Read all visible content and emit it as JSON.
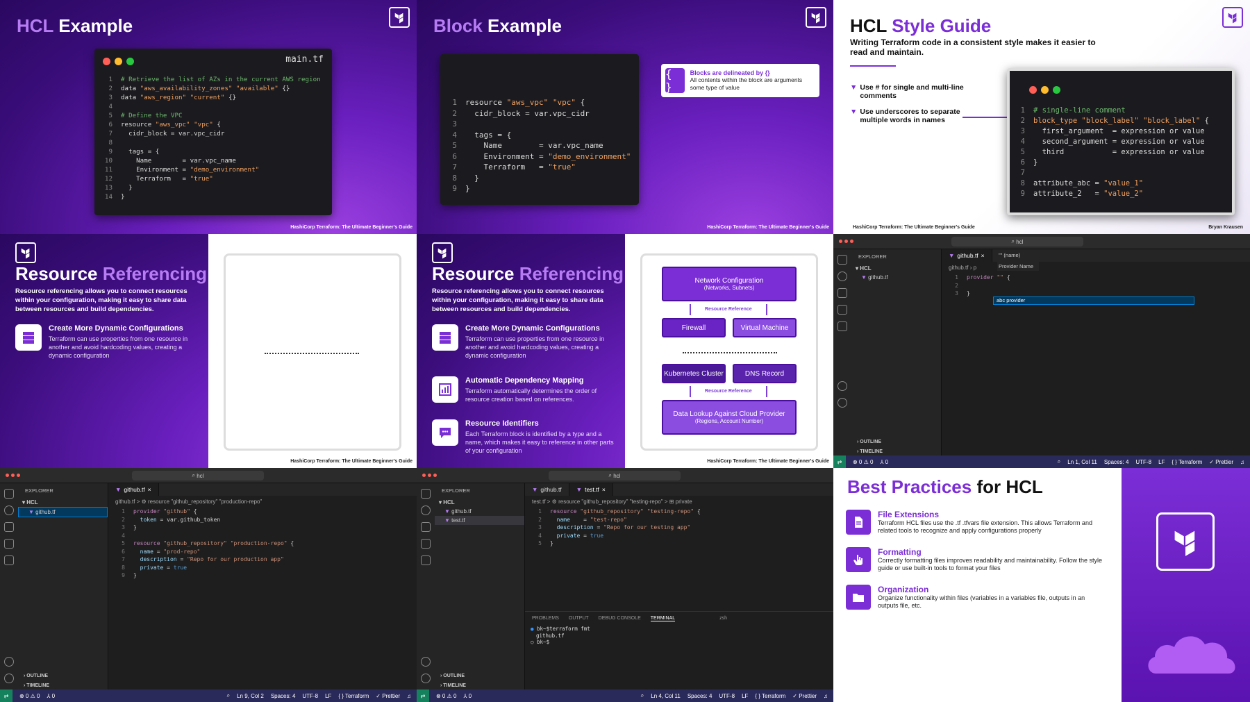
{
  "slides": {
    "hcl_example": {
      "title_accent": "HCL",
      "title_rest": " Example",
      "filename": "main.tf",
      "footer": "HashiCorp Terraform: The Ultimate Beginner's Guide",
      "lines": [
        {
          "n": "1",
          "html": "<span class='cm'># Retrieve the list of AZs in the current AWS region</span>"
        },
        {
          "n": "2",
          "html": "data <span class='st'>\"aws_availability_zones\"</span> <span class='st'>\"available\"</span> {}"
        },
        {
          "n": "3",
          "html": "data <span class='st'>\"aws_region\"</span> <span class='st'>\"current\"</span> {}"
        },
        {
          "n": "4",
          "html": ""
        },
        {
          "n": "5",
          "html": "<span class='cm'># Define the VPC</span>"
        },
        {
          "n": "6",
          "html": "resource <span class='st'>\"aws_vpc\"</span> <span class='st'>\"vpc\"</span> {"
        },
        {
          "n": "7",
          "html": "  cidr_block = var.vpc_cidr"
        },
        {
          "n": "8",
          "html": ""
        },
        {
          "n": "9",
          "html": "  tags = {"
        },
        {
          "n": "10",
          "html": "    Name        = var.vpc_name"
        },
        {
          "n": "11",
          "html": "    Environment = <span class='st'>\"demo_environment\"</span>"
        },
        {
          "n": "12",
          "html": "    Terraform   = <span class='st'>\"true\"</span>"
        },
        {
          "n": "13",
          "html": "  }"
        },
        {
          "n": "14",
          "html": "}"
        }
      ]
    },
    "block_example": {
      "title_accent": "Block",
      "title_rest": " Example",
      "callout_title": "Blocks are delineated by {}",
      "callout_desc": "All contents within the block are arguments some type of value",
      "footer": "HashiCorp Terraform: The Ultimate Beginner's Guide",
      "lines": [
        {
          "n": "1",
          "html": "resource <span class='st'>\"aws_vpc\"</span> <span class='st'>\"vpc\"</span> {"
        },
        {
          "n": "2",
          "html": "  cidr_block = var.vpc_cidr"
        },
        {
          "n": "3",
          "html": ""
        },
        {
          "n": "4",
          "html": "  tags = {"
        },
        {
          "n": "5",
          "html": "    Name        = var.vpc_name"
        },
        {
          "n": "6",
          "html": "    Environment = <span class='st'>\"demo_environment\"</span>"
        },
        {
          "n": "7",
          "html": "    Terraform   = <span class='st'>\"true\"</span>"
        },
        {
          "n": "8",
          "html": "  }"
        },
        {
          "n": "9",
          "html": "}"
        }
      ]
    },
    "style_guide": {
      "title_rest": "HCL ",
      "title_accent": "Style Guide",
      "subtitle": "Writing Terraform code in a consistent style makes it easier to read and maintain.",
      "bullet1": "Use # for single and multi-line comments",
      "bullet2": "Use underscores to separate multiple words in names",
      "footer_left": "HashiCorp Terraform: The Ultimate Beginner's Guide",
      "footer_right": "Bryan Krausen",
      "lines": [
        {
          "n": "1",
          "html": "<span class='cm'># single-line comment</span>"
        },
        {
          "n": "2",
          "html": "<span class='st'>block_type</span> <span class='st'>\"block_label\"</span> <span class='st'>\"block_label\"</span> {"
        },
        {
          "n": "3",
          "html": "  first_argument  = expression or value"
        },
        {
          "n": "4",
          "html": "  second_argument = expression or value"
        },
        {
          "n": "5",
          "html": "  third           = expression or value"
        },
        {
          "n": "6",
          "html": "}"
        },
        {
          "n": "7",
          "html": ""
        },
        {
          "n": "8",
          "html": "attribute_abc = <span class='st'>\"value_1\"</span>"
        },
        {
          "n": "9",
          "html": "attribute_2   = <span class='st'>\"value_2\"</span>"
        }
      ]
    },
    "resource_ref": {
      "title_rest": "Resource ",
      "title_accent": "Referencing",
      "intro": "Resource referencing allows you to connect resources within your configuration, making it easy to share data between resources and build dependencies.",
      "f1_title": "Create More Dynamic Configurations",
      "f1_desc": "Terraform can use properties from one resource in another and avoid hardcoding values, creating a dynamic configuration",
      "f2_title": "Automatic Dependency Mapping",
      "f2_desc": "Terraform automatically determines the order of resource creation based on references.",
      "f3_title": "Resource Identifiers",
      "f3_desc": "Each Terraform block is identified by a type and a name, which makes it easy to reference in other parts of your configuration",
      "footer": "HashiCorp Terraform: The Ultimate Beginner's Guide",
      "diagram": {
        "net_title": "Network Configuration",
        "net_sub": "(Networks, Subnets)",
        "ref_label": "Resource Reference",
        "firewall": "Firewall",
        "vm": "Virtual Machine",
        "k8s": "Kubernetes Cluster",
        "dns": "DNS Record",
        "lookup_title": "Data Lookup Against Cloud Provider",
        "lookup_sub": "(Regions, Account Number)"
      }
    },
    "vscode1": {
      "search": "hcl",
      "explorer": "EXPLORER",
      "folder": "HCL",
      "file": "github.tf",
      "tab": "github.tf",
      "crumb1": "github.tf",
      "crumb2": "p",
      "suggest_header": "\"\" (name)",
      "suggest_hint": "Provider Name",
      "suggest_item": "provider",
      "outline": "OUTLINE",
      "timeline": "TIMELINE",
      "status_errors": "⊗ 0 ⚠ 0",
      "status_ports": "⅄ 0",
      "status_pos": "Ln 1, Col 11",
      "status_spaces": "Spaces: 4",
      "status_enc": "UTF-8",
      "status_eol": "LF",
      "status_lang": "{ } Terraform",
      "status_fmt": "✓ Prettier",
      "lines": [
        {
          "n": "1",
          "html": "<span class='pu'>provider</span> <span class='or'>\"\"</span> {"
        },
        {
          "n": "2",
          "html": ""
        },
        {
          "n": "3",
          "html": "}"
        }
      ]
    },
    "vscode2": {
      "search": "hcl",
      "explorer": "EXPLORER",
      "folder": "HCL",
      "file": "github.tf",
      "tab": "github.tf",
      "crumb": "github.tf > ⚙ resource \"github_repository\" \"production-repo\"",
      "outline": "OUTLINE",
      "timeline": "TIMELINE",
      "status_errors": "⊗ 0 ⚠ 0",
      "status_ports": "⅄ 0",
      "status_pos": "Ln 9, Col 2",
      "status_spaces": "Spaces: 4",
      "status_enc": "UTF-8",
      "status_eol": "LF",
      "status_lang": "{ } Terraform",
      "status_fmt": "✓ Prettier",
      "lines": [
        {
          "n": "1",
          "html": "<span class='pu'>provider</span> <span class='or'>\"github\"</span> {"
        },
        {
          "n": "2",
          "html": "  <span class='blu'>token</span> = var.github_token"
        },
        {
          "n": "3",
          "html": "}"
        },
        {
          "n": "4",
          "html": ""
        },
        {
          "n": "5",
          "html": "<span class='pu'>resource</span> <span class='or'>\"github_repository\"</span> <span class='or'>\"production-repo\"</span> {"
        },
        {
          "n": "6",
          "html": "  <span class='blu'>name</span> = <span class='or'>\"prod-repo\"</span>"
        },
        {
          "n": "7",
          "html": "  <span class='blu'>description</span> = <span class='or'>\"Repo for our production app\"</span>"
        },
        {
          "n": "8",
          "html": "  <span class='blu'>private</span> = <span class='lb'>true</span>"
        },
        {
          "n": "9",
          "html": "}"
        }
      ]
    },
    "vscode3": {
      "search": "hcl",
      "explorer": "EXPLORER",
      "folder": "HCL",
      "file1": "github.tf",
      "file2": "test.tf",
      "tab1": "github.tf",
      "tab2": "test.tf",
      "crumb": "test.tf > ⚙ resource \"github_repository\" \"testing-repo\" > ⊞ private",
      "panel_tabs": [
        "PROBLEMS",
        "OUTPUT",
        "DEBUG CONSOLE",
        "TERMINAL"
      ],
      "shell": "zsh",
      "term1": "bk~$terraform fmt",
      "term2": "github.tf",
      "term3": "bk~$",
      "outline": "OUTLINE",
      "timeline": "TIMELINE",
      "status_errors": "⊗ 0 ⚠ 0",
      "status_ports": "⅄ 0",
      "status_pos": "Ln 4, Col 11",
      "status_spaces": "Spaces: 4",
      "status_enc": "UTF-8",
      "status_eol": "LF",
      "status_lang": "{ } Terraform",
      "status_fmt": "✓ Prettier",
      "lines": [
        {
          "n": "1",
          "html": "<span class='pu'>resource</span> <span class='or'>\"github_repository\"</span> <span class='or'>\"testing-repo\"</span> {"
        },
        {
          "n": "2",
          "html": "  <span class='blu'>name</span>    = <span class='or'>\"test-repo\"</span>"
        },
        {
          "n": "3",
          "html": "  <span class='blu'>description</span> = <span class='or'>\"Repo for our testing app\"</span>"
        },
        {
          "n": "4",
          "html": "  <span class='blu'>private</span> = <span class='lb'>true</span>"
        },
        {
          "n": "5",
          "html": "}"
        }
      ]
    },
    "best_practices": {
      "title_accent": "Best Practices",
      "title_rest": " for HCL",
      "i1_title": "File Extensions",
      "i1_desc": "Terraform HCL files use the .tf .tfvars file extension. This allows Terraform and related tools to recognize and apply configurations properly",
      "i2_title": "Formatting",
      "i2_desc": "Correctly formatting files improves readability and maintainability. Follow the style guide or use built-in tools to format your files",
      "i3_title": "Organization",
      "i3_desc": "Organize functionality within files (variables in a variables file, outputs in an outputs file, etc."
    }
  }
}
